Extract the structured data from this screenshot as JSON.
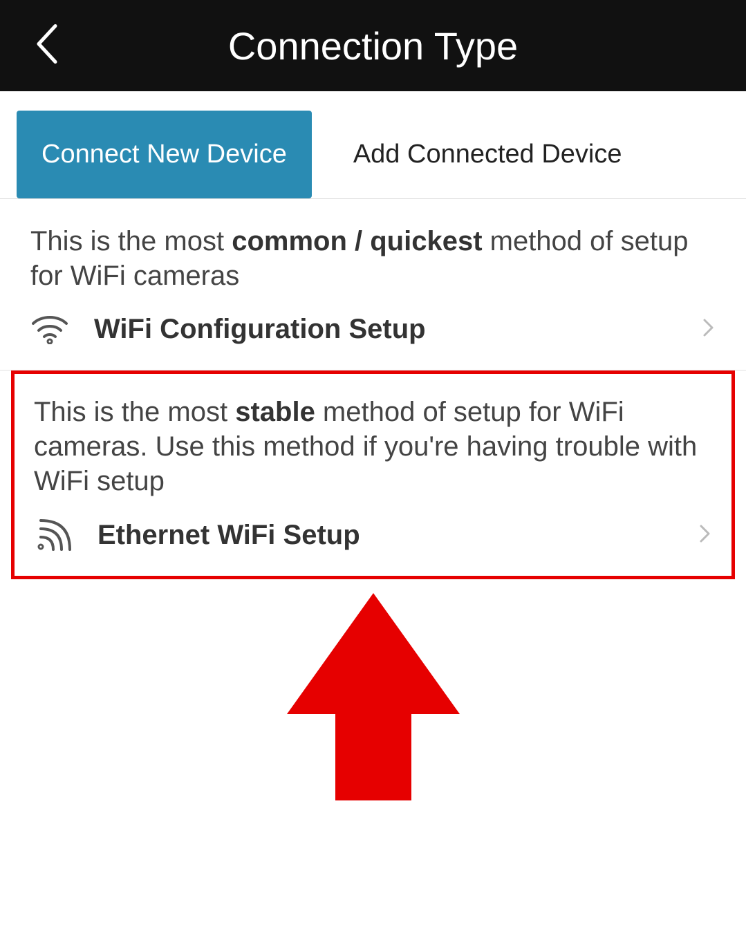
{
  "header": {
    "title": "Connection Type"
  },
  "tabs": {
    "connect_new": "Connect New Device",
    "add_connected": "Add Connected Device"
  },
  "wifi_section": {
    "desc_pre": "This is the most ",
    "desc_bold": "common / quickest",
    "desc_post": " method of setup for WiFi cameras",
    "option_label": "WiFi Configuration Setup"
  },
  "ethernet_section": {
    "desc_pre": "This is the most ",
    "desc_bold": "stable",
    "desc_post": " method of setup for WiFi cameras. Use this method if you're having trouble with WiFi setup",
    "option_label": "Ethernet WiFi Setup"
  }
}
